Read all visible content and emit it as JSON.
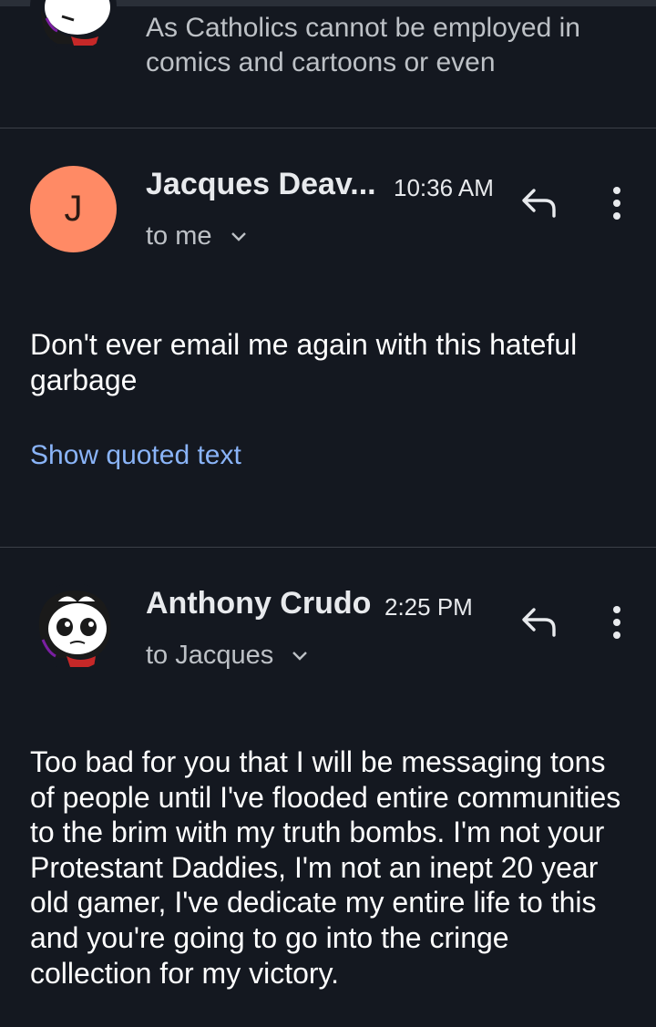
{
  "thread": {
    "collapsed_message": {
      "snippet": "As Catholics cannot be employed in comics and cartoons or even"
    },
    "messages": [
      {
        "sender": "Jacques Deav...",
        "avatar_letter": "J",
        "avatar_color": "#ff8a65",
        "time": "10:36 AM",
        "recipient": "to me",
        "body": "Don't ever email me again with this hateful garbage",
        "show_quoted_label": "Show quoted text"
      },
      {
        "sender": "Anthony Crudo",
        "time": "2:25 PM",
        "recipient": "to Jacques",
        "body": "Too bad for you that I will be messaging tons of people until I've flooded entire communities to the brim with my truth bombs. I'm not your Protestant Daddies, I'm not an inept 20 year old gamer, I've dedicate my entire life to this and you're going to go into the cringe collection for my victory."
      }
    ]
  },
  "icons": {
    "reply": "reply-icon",
    "more": "more-vert-icon",
    "chevron": "chevron-down-icon"
  },
  "colors": {
    "background": "#141820",
    "link": "#8ab4f8",
    "secondary_text": "#bdc1c6"
  }
}
